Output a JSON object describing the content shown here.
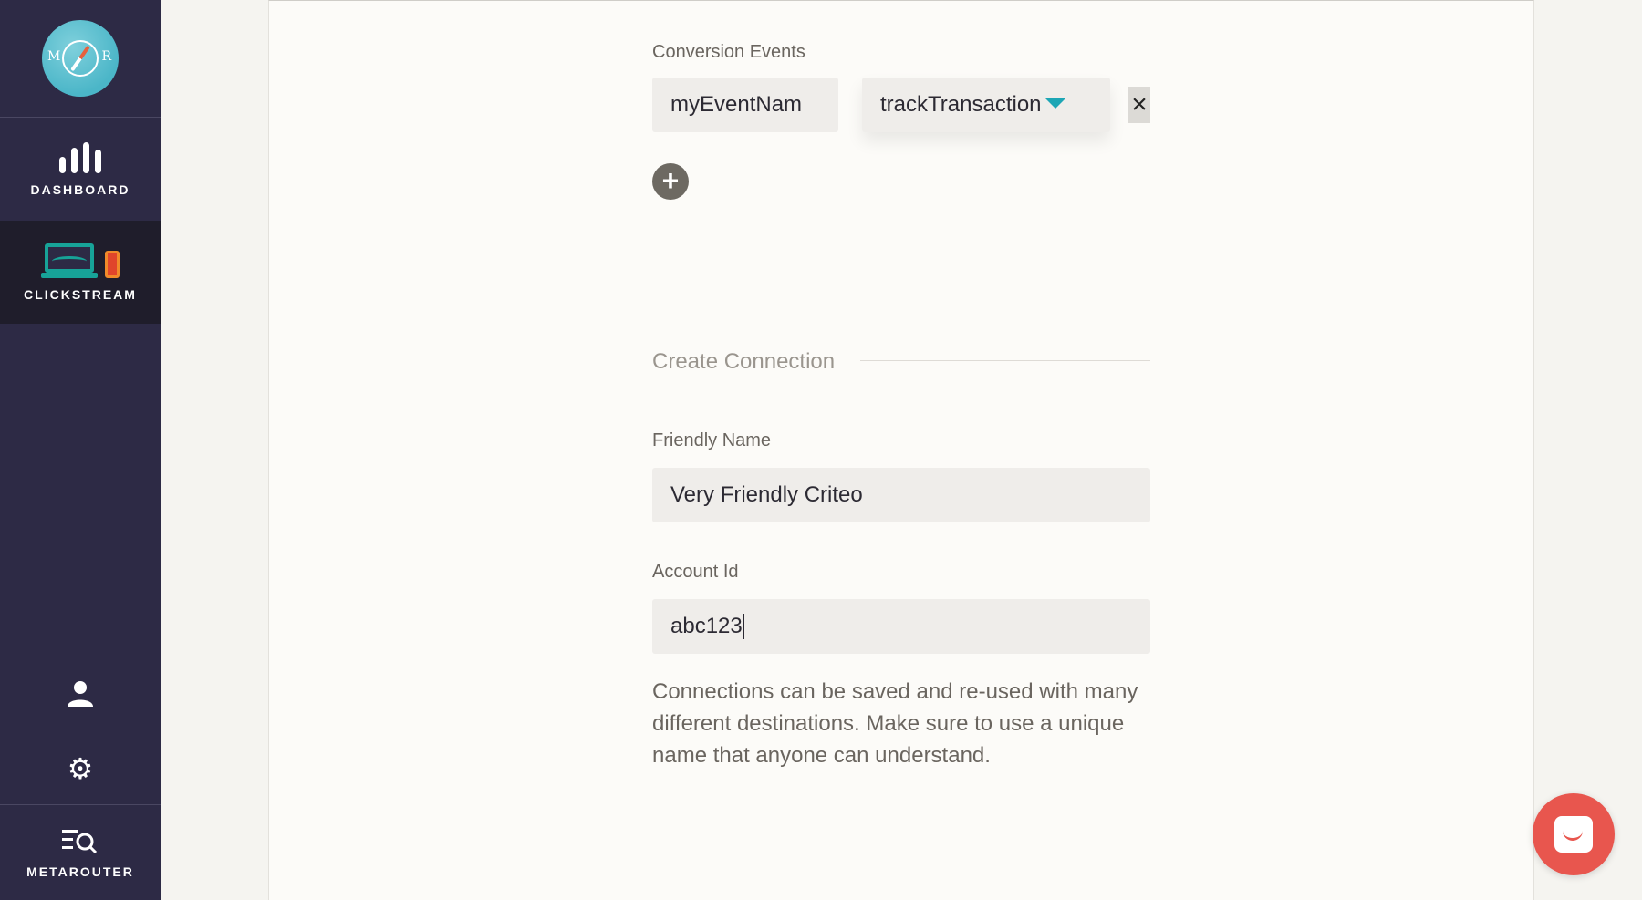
{
  "sidebar": {
    "logo": {
      "left_letter": "M",
      "right_letter": "R"
    },
    "items": [
      {
        "label": "DASHBOARD",
        "icon": "bar-chart-icon"
      },
      {
        "label": "CLICKSTREAM",
        "icon": "laptop-phone-icon",
        "active": true
      }
    ],
    "bottom": {
      "user_icon": "user-icon",
      "settings_icon": "gear-icon",
      "label": "METAROUTER",
      "icon": "list-search-icon"
    }
  },
  "form": {
    "conversion_events_label": "Conversion Events",
    "event_name_value": "myEventNam",
    "event_method_value": "trackTransaction",
    "remove_symbol": "×",
    "add_symbol": "+",
    "section_title": "Create Connection",
    "friendly_name_label": "Friendly Name",
    "friendly_name_value": "Very Friendly Criteo",
    "account_id_label": "Account Id",
    "account_id_value": "abc123",
    "helper_text": "Connections can be saved and re-used with many different destinations. Make sure to use a unique name that anyone can understand."
  },
  "colors": {
    "sidebar_bg": "#2d2a45",
    "sidebar_active_bg": "#1f1d2b",
    "accent_teal": "#1da6b5",
    "chat_red": "#e8564e"
  }
}
